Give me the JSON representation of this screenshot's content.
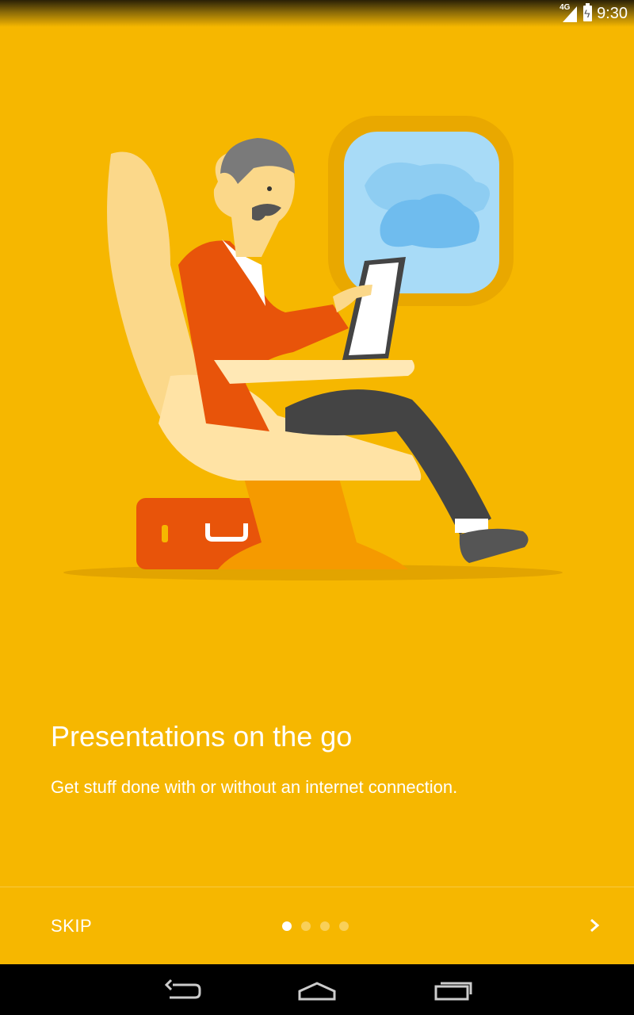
{
  "status_bar": {
    "network_label": "4G",
    "time": "9:30",
    "icons": [
      "signal-icon",
      "battery-charging-icon"
    ]
  },
  "onboarding": {
    "title": "Presentations on the go",
    "description": "Get stuff done with or without an internet connection.",
    "illustration": "man-on-airplane-with-tablet",
    "current_page": 1,
    "total_pages": 4
  },
  "footer": {
    "skip_label": "SKIP",
    "next_icon": "chevron-right-icon"
  },
  "nav_bar": {
    "buttons": [
      "back-icon",
      "home-icon",
      "recents-icon"
    ]
  },
  "colors": {
    "background": "#F6B700",
    "sweater": "#E8540A",
    "seat": "#FBD88A",
    "window_sky": "#A8DBF7",
    "pants": "#444444"
  }
}
